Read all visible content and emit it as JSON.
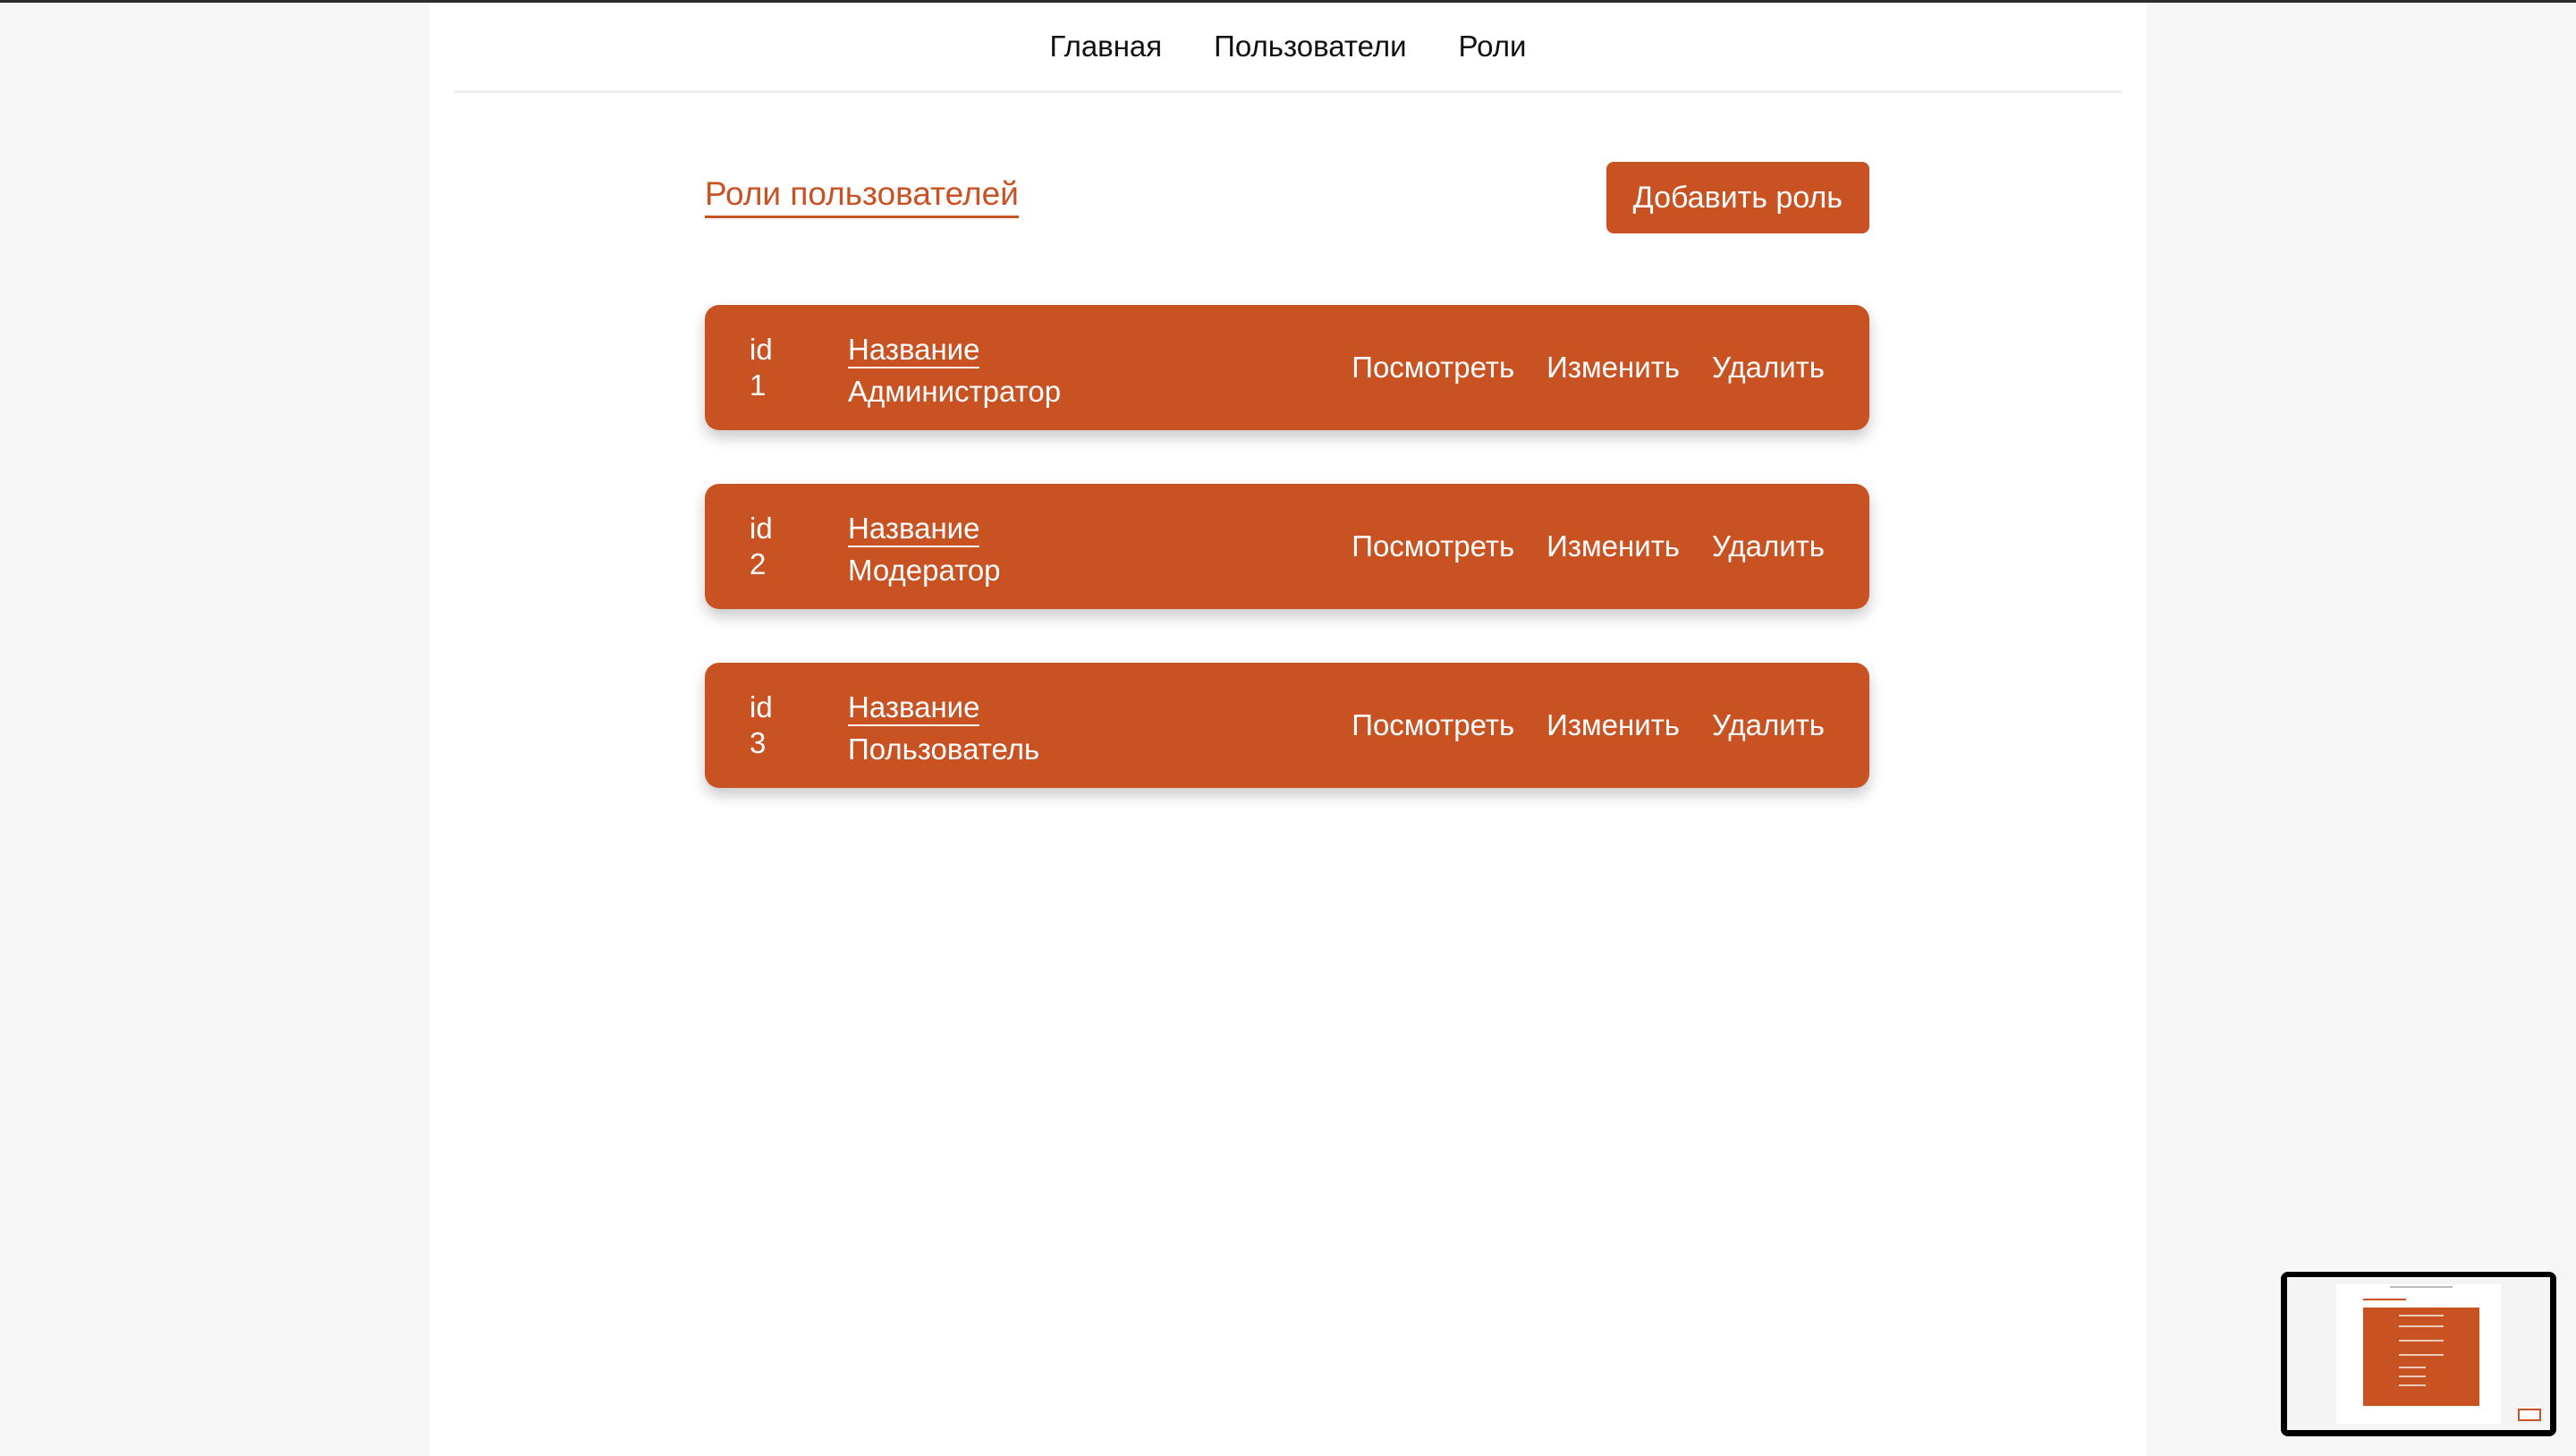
{
  "nav": {
    "items": [
      {
        "label": "Главная"
      },
      {
        "label": "Пользователи"
      },
      {
        "label": "Роли"
      }
    ]
  },
  "header": {
    "title": "Роли пользователей",
    "add_button_label": "Добавить роль"
  },
  "roles": [
    {
      "id_label": "id",
      "id": "1",
      "name_label": "Название",
      "name": "Администратор"
    },
    {
      "id_label": "id",
      "id": "2",
      "name_label": "Название",
      "name": "Модератор"
    },
    {
      "id_label": "id",
      "id": "3",
      "name_label": "Название",
      "name": "Пользователь"
    }
  ],
  "actions": {
    "view": "Посмотреть",
    "edit": "Изменить",
    "delete": "Удалить"
  },
  "colors": {
    "accent": "#c95223",
    "page_bg": "#f6f6f6",
    "content_bg": "#ffffff"
  },
  "icons": {
    "preview": "screen-preview-thumbnail"
  }
}
